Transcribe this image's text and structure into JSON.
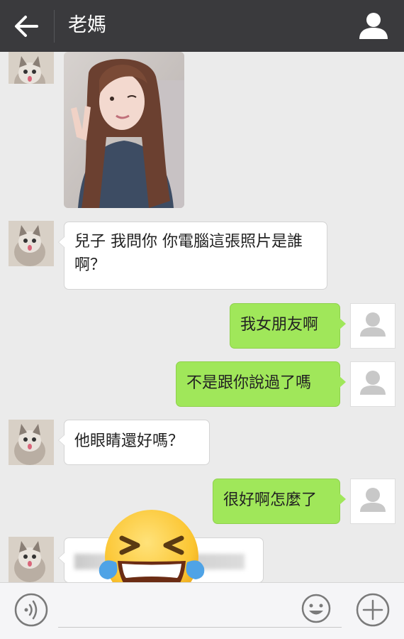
{
  "header": {
    "title": "老媽",
    "back_icon": "arrow-left-icon",
    "profile_icon": "user-icon",
    "background": "#3a3a3d"
  },
  "messages": [
    {
      "side": "in",
      "type": "image",
      "description": "photo"
    },
    {
      "side": "in",
      "type": "text",
      "text": "兒子 我問你 你電腦這張照片是誰啊？"
    },
    {
      "side": "out",
      "type": "text",
      "text": "我女朋友啊"
    },
    {
      "side": "out",
      "type": "text",
      "text": "不是跟你說過了嗎"
    },
    {
      "side": "in",
      "type": "text",
      "text": "他眼睛還好嗎？"
    },
    {
      "side": "out",
      "type": "text",
      "text": "很好啊怎麼了"
    },
    {
      "side": "in",
      "type": "text",
      "text": ""
    }
  ],
  "overlay": {
    "emoji": "laughing-tears-emoji"
  },
  "inputbar": {
    "voice_icon": "voice-icon",
    "emoji_icon": "smile-icon",
    "plus_icon": "plus-icon"
  },
  "colors": {
    "incoming_bubble": "#ffffff",
    "outgoing_bubble": "#a0e75a",
    "chat_background": "#ebebeb"
  }
}
